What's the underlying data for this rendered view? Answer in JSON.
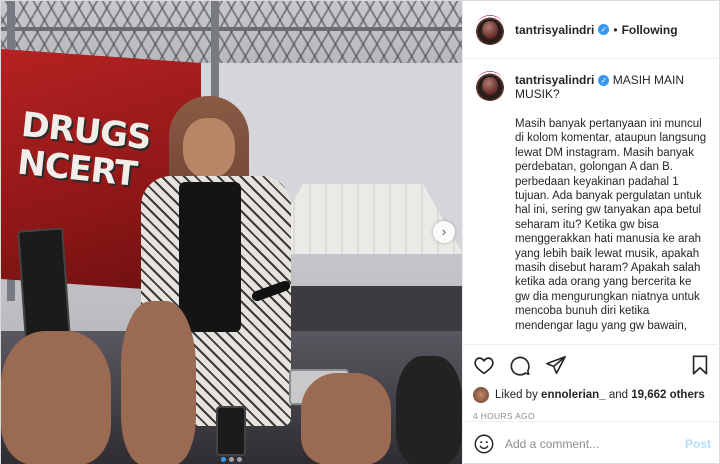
{
  "post": {
    "username": "tantrisyalindri",
    "follow_separator": "•",
    "follow_label": "Following",
    "caption_title": "MASIH MAIN MUSIK?",
    "caption_body": "Masih banyak pertanyaan ini muncul di kolom komentar, ataupun langsung lewat DM instagram. Masih banyak perdebatan, golongan A dan B. perbedaan keyakinan padahal 1 tujuan. Ada banyak pergulatan untuk hal ini, sering gw tanyakan apa betul seharam itu? Ketika gw bisa menggerakkan hati manusia ke arah yang lebih baik lewat musik, apakah masih disebut haram? Apakah salah ketika ada orang yang bercerita ke gw dia mengurungkan niatnya untuk mencoba bunuh diri ketika mendengar lagu yang gw bawain,",
    "likes_prefix": "Liked by",
    "liked_by_user": "ennolerian_",
    "likes_others": "19,662 others",
    "likes_conjunction": "and",
    "time_ago": "4 HOURS AGO",
    "comment_placeholder": "Add a comment...",
    "post_button": "Post"
  },
  "photo": {
    "banner_text": "DRUGS\nNCERT",
    "carousel_dots": 3,
    "active_dot": 0,
    "next_arrow": "›"
  },
  "icons": {
    "verified": "verified-badge-icon",
    "like": "heart-icon",
    "comment": "comment-bubble-icon",
    "share": "paper-plane-icon",
    "save": "bookmark-icon",
    "emoji": "smiley-icon"
  },
  "colors": {
    "accent": "#3897f0",
    "muted": "#8e8e8e",
    "post_disabled": "#b2dffc",
    "banner_red": "#a31c1c"
  }
}
